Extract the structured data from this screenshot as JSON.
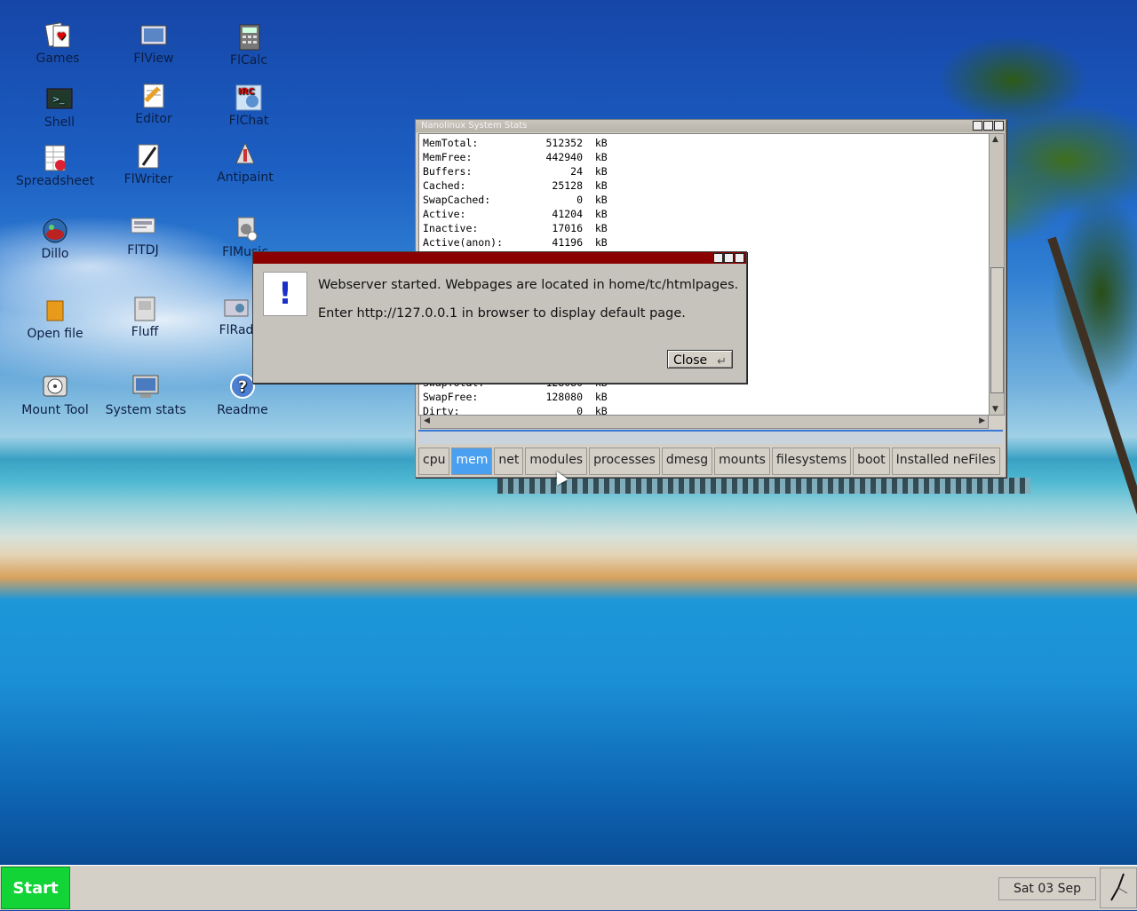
{
  "desktop": {
    "icons": [
      {
        "label": "Games",
        "icon": "cards-icon"
      },
      {
        "label": "FlView",
        "icon": "image-viewer-icon"
      },
      {
        "label": "FlCalc",
        "icon": "calculator-icon"
      },
      {
        "label": "Shell",
        "icon": "terminal-icon"
      },
      {
        "label": "Editor",
        "icon": "editor-icon"
      },
      {
        "label": "FlChat",
        "icon": "irc-chat-icon"
      },
      {
        "label": "Spreadsheet",
        "icon": "spreadsheet-icon"
      },
      {
        "label": "FlWriter",
        "icon": "writer-icon"
      },
      {
        "label": "Antipaint",
        "icon": "paint-icon"
      },
      {
        "label": "Dillo",
        "icon": "browser-icon"
      },
      {
        "label": "FlTDJ",
        "icon": "dj-icon"
      },
      {
        "label": "FlMusic",
        "icon": "music-icon"
      },
      {
        "label": "Open file",
        "icon": "open-file-icon"
      },
      {
        "label": "Fluff",
        "icon": "file-manager-icon"
      },
      {
        "label": "FlRad",
        "icon": "radio-icon"
      },
      {
        "label": "Mount Tool",
        "icon": "mount-tool-icon"
      },
      {
        "label": "System stats",
        "icon": "monitor-icon"
      },
      {
        "label": "Readme",
        "icon": "help-icon"
      }
    ]
  },
  "stats_window": {
    "title": "Nanolinux System Stats",
    "lines_top": "MemTotal:           512352  kB\nMemFree:            442940  kB\nBuffers:                24  kB\nCached:              25128  kB\nSwapCached:              0  kB\nActive:              41204  kB\nInactive:            17016  kB\nActive(anon):        41196  kB",
    "lines_bottom": "SwapTotal:          128080  kB\nSwapFree:           128080  kB\nDirty:                   0  kB",
    "tabs": [
      "cpu",
      "mem",
      "net",
      "modules",
      "processes",
      "dmesg",
      "mounts",
      "filesystems",
      "boot",
      "Installed neFiles"
    ],
    "active_tab": "mem"
  },
  "dialog": {
    "icon_glyph": "!",
    "message_line1": "Webserver started. Webpages are located in home/tc/htmlpages.",
    "message_line2": "Enter http://127.0.0.1 in browser to display default page.",
    "close_label": "Close",
    "close_glyph": "↵"
  },
  "taskbar": {
    "start_label": "Start",
    "date": "Sat 03 Sep"
  },
  "colors": {
    "start_green": "#12d436",
    "dialog_title": "#8b0000",
    "active_tab": "#4aa0f0"
  }
}
